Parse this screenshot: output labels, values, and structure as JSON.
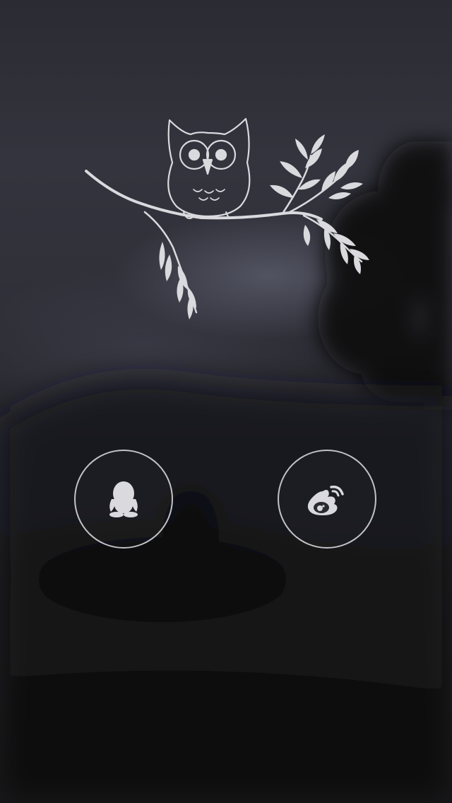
{
  "screen": {
    "background": "blurred-night-landscape",
    "colors": {
      "background_top": "#2b2b33",
      "background_bottom": "#121215",
      "line_art": "#d9d9de",
      "button_border": "#e1e1e8"
    }
  },
  "illustration": {
    "icon": "owl-on-branch-icon"
  },
  "login_options": [
    {
      "id": "qq",
      "icon": "qq-penguin-icon"
    },
    {
      "id": "weibo",
      "icon": "weibo-icon"
    }
  ]
}
